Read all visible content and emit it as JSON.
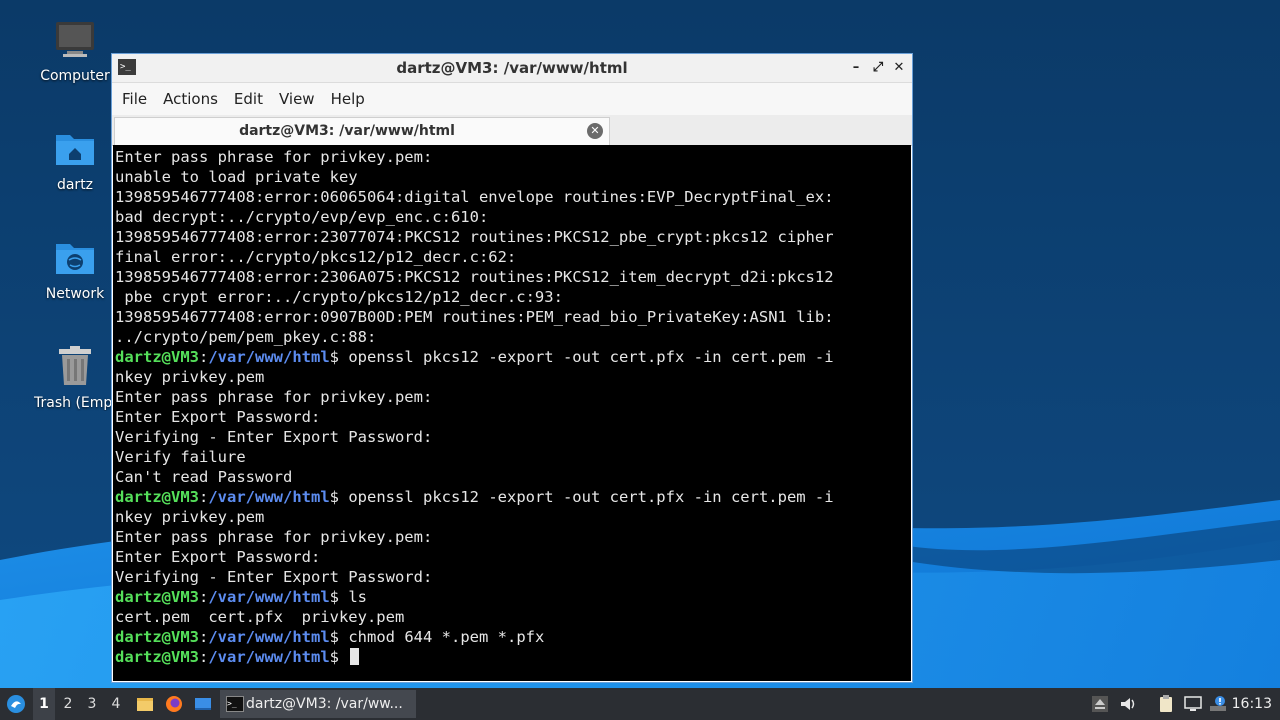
{
  "desktop": {
    "icons": [
      {
        "label": "Computer",
        "icon": "computer-icon"
      },
      {
        "label": "dartz",
        "icon": "home-folder-icon"
      },
      {
        "label": "Network",
        "icon": "network-folder-icon"
      },
      {
        "label": "Trash (Empty)",
        "icon": "trash-icon"
      }
    ]
  },
  "window": {
    "title": "dartz@VM3: /var/www/html",
    "controls": {
      "minimize": "–",
      "maximize": "⤢",
      "close": "✕"
    },
    "menu": [
      "File",
      "Actions",
      "Edit",
      "View",
      "Help"
    ],
    "tab": {
      "label": "dartz@VM3: /var/www/html",
      "close": "✕"
    }
  },
  "prompt": {
    "user": "dartz@VM3",
    "colon": ":",
    "path": "/var/www/html",
    "sigil": "$ "
  },
  "terminal": {
    "lines": [
      {
        "text": "Enter pass phrase for privkey.pem:"
      },
      {
        "text": "unable to load private key"
      },
      {
        "text": "139859546777408:error:06065064:digital envelope routines:EVP_DecryptFinal_ex:"
      },
      {
        "text": "bad decrypt:../crypto/evp/evp_enc.c:610:"
      },
      {
        "text": "139859546777408:error:23077074:PKCS12 routines:PKCS12_pbe_crypt:pkcs12 cipher"
      },
      {
        "text": "final error:../crypto/pkcs12/p12_decr.c:62:"
      },
      {
        "text": "139859546777408:error:2306A075:PKCS12 routines:PKCS12_item_decrypt_d2i:pkcs12"
      },
      {
        "text": " pbe crypt error:../crypto/pkcs12/p12_decr.c:93:"
      },
      {
        "text": "139859546777408:error:0907B00D:PEM routines:PEM_read_bio_PrivateKey:ASN1 lib:"
      },
      {
        "text": "../crypto/pem/pem_pkey.c:88:"
      },
      {
        "prompt": true,
        "text": "openssl pkcs12 -export -out cert.pfx -in cert.pem -i"
      },
      {
        "text": "nkey privkey.pem"
      },
      {
        "text": "Enter pass phrase for privkey.pem:"
      },
      {
        "text": "Enter Export Password:"
      },
      {
        "text": "Verifying - Enter Export Password:"
      },
      {
        "text": "Verify failure"
      },
      {
        "text": "Can't read Password"
      },
      {
        "prompt": true,
        "text": "openssl pkcs12 -export -out cert.pfx -in cert.pem -i"
      },
      {
        "text": "nkey privkey.pem"
      },
      {
        "text": "Enter pass phrase for privkey.pem:"
      },
      {
        "text": "Enter Export Password:"
      },
      {
        "text": "Verifying - Enter Export Password:"
      },
      {
        "prompt": true,
        "text": "ls"
      },
      {
        "text": "cert.pem  cert.pfx  privkey.pem"
      },
      {
        "prompt": true,
        "text": "chmod 644 *.pem *.pfx"
      },
      {
        "prompt": true,
        "text": "",
        "cursor": true
      }
    ]
  },
  "taskbar": {
    "workspaces": [
      "1",
      "2",
      "3",
      "4"
    ],
    "active_workspace": "1",
    "task_label": "dartz@VM3: /var/ww...",
    "clock": "16:13",
    "tray_icons": [
      "eject-icon",
      "volume-icon",
      "clipboard-icon",
      "network-icon",
      "update-icon"
    ]
  },
  "colors": {
    "prompt_user": "#55e05a",
    "prompt_path": "#5c8cf0",
    "terminal_bg": "#000000",
    "window_border": "#6aa0d8"
  }
}
